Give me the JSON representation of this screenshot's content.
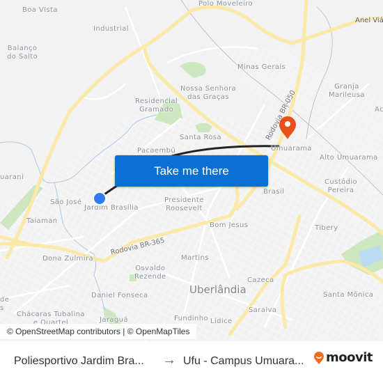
{
  "map": {
    "neighborhoods": [
      {
        "name": "Boa VIsta"
      },
      {
        "name": "Industrial"
      },
      {
        "name": "Balanço\ndo Salto"
      },
      {
        "name": "Polo Moveleiro"
      },
      {
        "name": "Minas Gerais"
      },
      {
        "name": "Granja\nMarileusa"
      },
      {
        "name": "Nossa Senhora\ndas Graças"
      },
      {
        "name": "Residencial\nGramado"
      },
      {
        "name": "Santa Rosa"
      },
      {
        "name": "Pacaembú"
      },
      {
        "name": "Umuarama"
      },
      {
        "name": "Alto Umuarama"
      },
      {
        "name": "uarani"
      },
      {
        "name": "São José"
      },
      {
        "name": "Jardim Brasília"
      },
      {
        "name": "Presidente\nRoosevelt"
      },
      {
        "name": "Brasil"
      },
      {
        "name": "Custódio\nPereira"
      },
      {
        "name": "Taiaman"
      },
      {
        "name": "Bom Jesus"
      },
      {
        "name": "Tibery"
      },
      {
        "name": "Dona Zulmira"
      },
      {
        "name": "Martins"
      },
      {
        "name": "Osvaldo\nRezende"
      },
      {
        "name": "Cazeca"
      },
      {
        "name": "Santa Mônica"
      },
      {
        "name": "Daniel Fonseca"
      },
      {
        "name": "Saraiva"
      },
      {
        "name": "Chácaras Tubalina\ne Quartel"
      },
      {
        "name": "Jaraguá"
      },
      {
        "name": "Fundinho"
      },
      {
        "name": "Lídice"
      },
      {
        "name": "de\ns"
      },
      {
        "name": "Ac"
      }
    ],
    "city": "Uberlândia",
    "roads": {
      "br365": "Rodovia BR-365",
      "br050": "Rodovia BR-050",
      "anel": "Anel Viá"
    },
    "colors": {
      "background": "#f2f2f3",
      "road_major": "#fbe9a8",
      "park": "#cde8c0",
      "water": "#bcdcf3",
      "route": "#222222",
      "origin": "#2f7bf0",
      "destination": "#e8501c"
    }
  },
  "cta": {
    "label": "Take me there",
    "color": "#0a70d4"
  },
  "attribution": "© OpenStreetMap contributors | © OpenMapTiles",
  "footer": {
    "origin": "Poliesportivo Jardim Bra...",
    "arrow": "→",
    "destination": "Ufu - Campus Umuara...",
    "brand": "moovit",
    "brand_color": "#f26b1d"
  }
}
